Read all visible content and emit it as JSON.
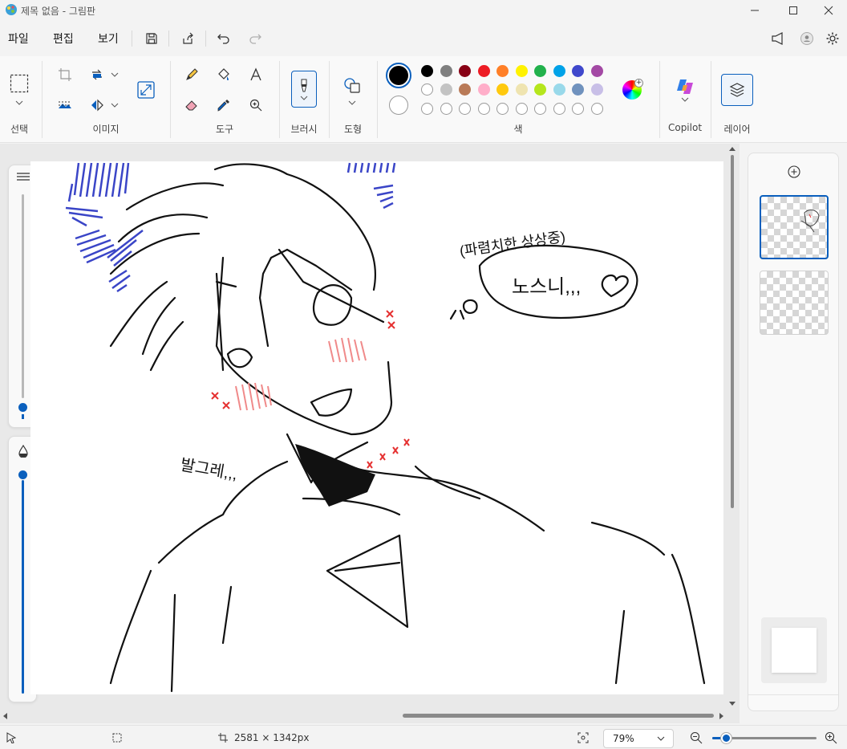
{
  "window": {
    "title": "제목 없음 - 그림판",
    "controls": {
      "minimize": "minimize-icon",
      "maximize": "maximize-icon",
      "close": "close-icon"
    }
  },
  "menu": {
    "file": "파일",
    "edit": "편집",
    "view": "보기",
    "icons": [
      "save-icon",
      "share-icon",
      "undo-icon",
      "redo-icon",
      "feedback-icon",
      "account-icon",
      "settings-icon"
    ]
  },
  "ribbon": {
    "groups": {
      "select": "선택",
      "image": "이미지",
      "tools": "도구",
      "brush": "브러시",
      "shapes": "도형",
      "colors": "색",
      "copilot": "Copilot",
      "layers": "레이어"
    },
    "colors": {
      "primary": "#000000",
      "secondary": "#ffffff",
      "palette_row1": [
        "#000000",
        "#7f7f7f",
        "#880015",
        "#ed1c24",
        "#ff7f27",
        "#fff200",
        "#22b14c",
        "#00a2e8",
        "#3f48cc",
        "#a349a4"
      ],
      "palette_row2": [
        "#ffffff",
        "#c3c3c3",
        "#b97a57",
        "#ffaec9",
        "#ffc90e",
        "#efe4b0",
        "#b5e61d",
        "#99d9ea",
        "#7092be",
        "#c8bfe7"
      ],
      "palette_row3_empty_count": 10
    }
  },
  "canvas": {
    "texts": {
      "thought": "(파렴치한 상상중)",
      "bubble": "노스니,,,",
      "murmur": "발그레,,,"
    }
  },
  "status": {
    "image_size": "2581 × 1342px",
    "zoom": "79%"
  }
}
